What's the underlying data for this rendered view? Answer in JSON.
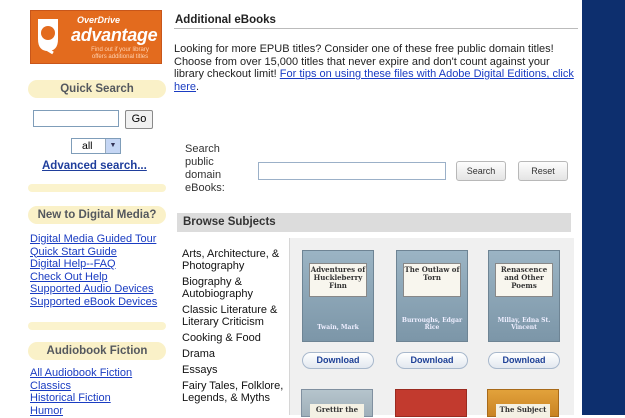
{
  "logo": {
    "top": "OverDrive",
    "main": "advantage",
    "sub": "Find out if your library offers additional titles"
  },
  "sidebar": {
    "quick_search": {
      "heading": "Quick Search",
      "input_value": "",
      "go_label": "Go",
      "select_value": "all",
      "advanced_link": "Advanced search..."
    },
    "digital_media": {
      "heading": "New to Digital Media?",
      "links": [
        "Digital Media Guided Tour",
        "Quick Start Guide",
        "Digital Help--FAQ",
        "Check Out Help",
        "Supported Audio Devices",
        "Supported eBook Devices"
      ]
    },
    "audiobook_fiction": {
      "heading": "Audiobook Fiction",
      "links": [
        "All Audiobook Fiction",
        "Classics",
        "Historical Fiction",
        "Humor"
      ]
    }
  },
  "main": {
    "title": "Additional eBooks",
    "intro_text": "Looking for more EPUB titles? Consider one of these free public domain titles! Choose from over 15,000 titles that never expire and don't count against your library checkout limit! ",
    "intro_link": "For tips on using these files with Adobe Digital Editions, click here",
    "intro_end": ".",
    "search": {
      "label": "Search public domain eBooks:",
      "input_value": "",
      "search_label": "Search",
      "reset_label": "Reset"
    },
    "browse_heading": "Browse Subjects",
    "subjects": [
      "Arts, Architecture, & Photography",
      "Biography & Autobiography",
      "Classic Literature & Literary Criticism",
      "Cooking & Food",
      "Drama",
      "Essays",
      "Fairy Tales, Folklore, Legends, & Myths"
    ],
    "books": [
      {
        "title": "Adventures of Huckleberry Finn",
        "author": "Twain, Mark",
        "download": "Download"
      },
      {
        "title": "The Outlaw of Torn",
        "author": "Burroughs, Edgar Rice",
        "download": "Download"
      },
      {
        "title": "Renascence and Other Poems",
        "author": "Millay, Edna St. Vincent",
        "download": "Download"
      }
    ],
    "books_row2": [
      "Grettir the",
      "",
      "The Subject"
    ]
  },
  "colors": {
    "right_band": "#0d2f6e",
    "logo_orange": "#e36b1e",
    "heading_bg": "#faf1c8",
    "link": "#1a3cc2"
  }
}
